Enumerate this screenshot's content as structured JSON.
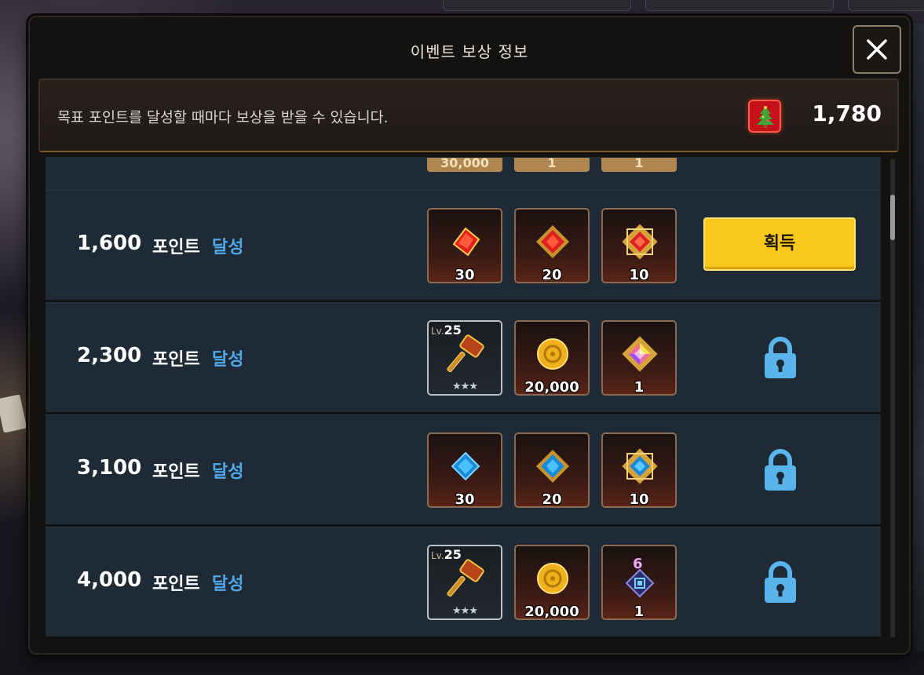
{
  "dialog": {
    "title": "이벤트 보상 정보",
    "description": "목표 포인트를 달성할 때마다 보상을 받을 수 있습니다.",
    "current_points": "1,780",
    "point_icon": "christmas-tree-icon",
    "close_icon": "close-icon"
  },
  "partial_row": {
    "badges": [
      "30,000",
      "1",
      "1"
    ]
  },
  "rows": [
    {
      "points": "1,600",
      "word": "포인트",
      "achieve": "달성",
      "rewards": [
        {
          "icon": "red-gem-icon",
          "qty": "30"
        },
        {
          "icon": "red-gem-framed-icon",
          "qty": "20"
        },
        {
          "icon": "red-gem-gold-frame-icon",
          "qty": "10"
        }
      ],
      "state": "claimable",
      "button_label": "획득"
    },
    {
      "points": "2,300",
      "word": "포인트",
      "achieve": "달성",
      "rewards": [
        {
          "icon": "hammer-icon",
          "lv_prefix": "Lv.",
          "lv": "25",
          "stars": "★★★"
        },
        {
          "icon": "gold-coin-icon",
          "qty": "20,000"
        },
        {
          "icon": "rainbow-gem-icon",
          "qty": "1"
        }
      ],
      "state": "locked"
    },
    {
      "points": "3,100",
      "word": "포인트",
      "achieve": "달성",
      "rewards": [
        {
          "icon": "blue-gem-icon",
          "qty": "30"
        },
        {
          "icon": "blue-gem-framed-icon",
          "qty": "20"
        },
        {
          "icon": "blue-gem-gold-frame-icon",
          "qty": "10"
        }
      ],
      "state": "locked"
    },
    {
      "points": "4,000",
      "word": "포인트",
      "achieve": "달성",
      "rewards": [
        {
          "icon": "hammer-icon",
          "lv_prefix": "Lv.",
          "lv": "25",
          "stars": "★★★"
        },
        {
          "icon": "gold-coin-icon",
          "qty": "20,000"
        },
        {
          "icon": "rune-card-icon",
          "grade": "6",
          "qty": "1"
        }
      ],
      "state": "locked"
    }
  ],
  "colors": {
    "claim_button": "#f8c81c",
    "achieve_text": "#4fa8e8",
    "lock": "#5ab4ec",
    "row_bg": "#1e2a35"
  }
}
